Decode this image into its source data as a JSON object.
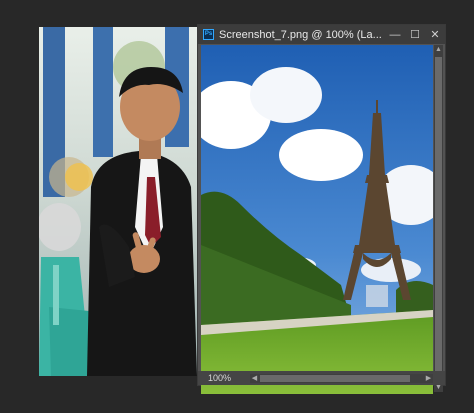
{
  "document_window": {
    "title": "Screenshot_7.png @ 100% (La...",
    "app_badge": "Ps",
    "zoom": "100%",
    "buttons": {
      "minimize": "—",
      "maximize": "☐",
      "close": "✕"
    }
  },
  "icons": {
    "app": "photoshop-icon",
    "minimize": "minimize-icon",
    "maximize": "maximize-icon",
    "close": "close-icon"
  },
  "colors": {
    "workspace": "#282828",
    "titlebar": "#3c3c3c",
    "sky": "#2f6fbf",
    "grass": "#6aa42a"
  }
}
